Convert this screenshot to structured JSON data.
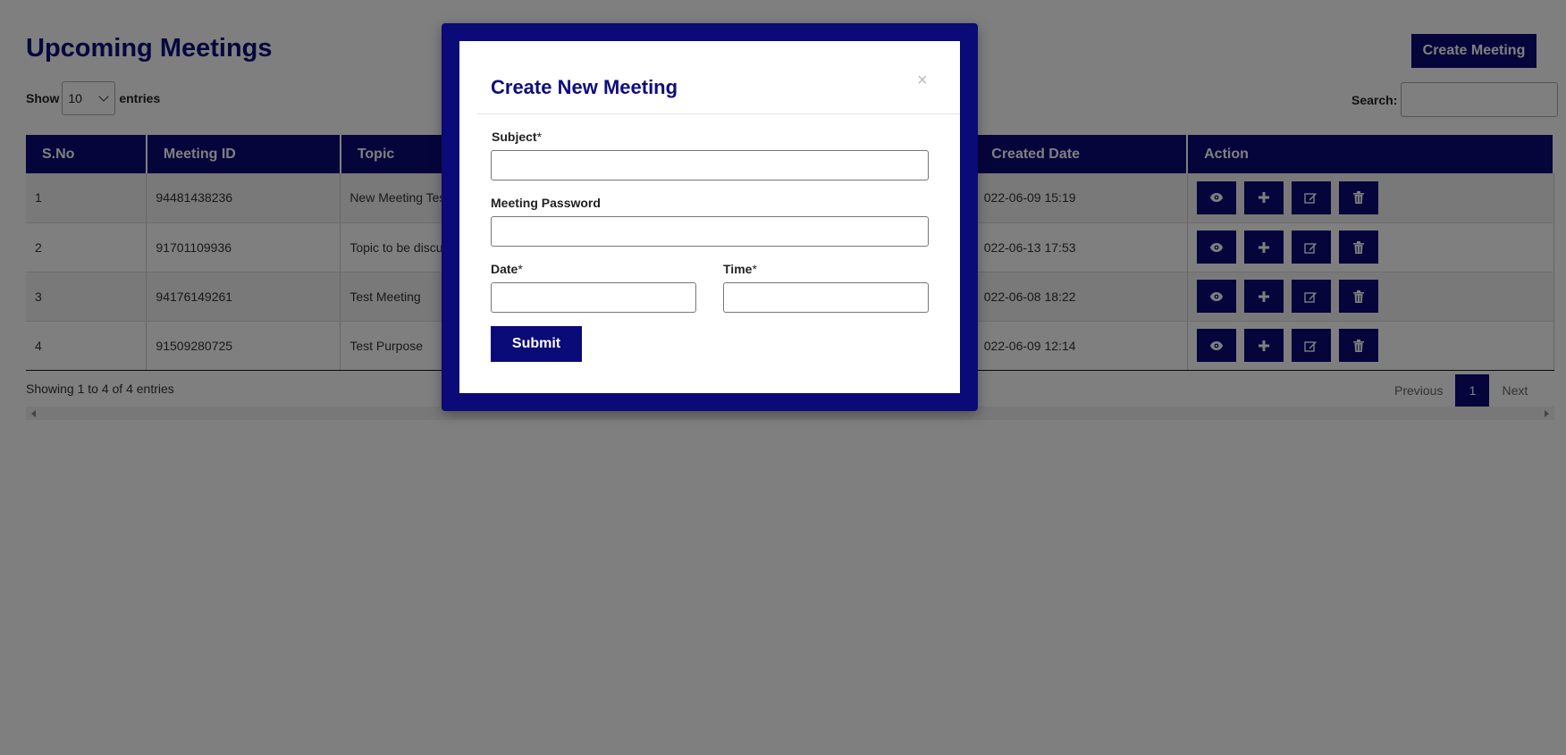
{
  "header": {
    "title": "Upcoming Meetings",
    "create_button": "Create Meeting"
  },
  "length_control": {
    "prefix": "Show",
    "value": "10",
    "suffix": "entries"
  },
  "search": {
    "label": "Search:",
    "value": ""
  },
  "table": {
    "columns": [
      "S.No",
      "Meeting ID",
      "Topic",
      "Created Date",
      "Action"
    ],
    "rows": [
      {
        "sno": "1",
        "meeting_id": "94481438236",
        "topic": "New Meeting Tes",
        "created": "022-06-09 15:19"
      },
      {
        "sno": "2",
        "meeting_id": "91701109936",
        "topic": "Topic to be discu",
        "created": "022-06-13 17:53"
      },
      {
        "sno": "3",
        "meeting_id": "94176149261",
        "topic": "Test Meeting",
        "created": "022-06-08 18:22"
      },
      {
        "sno": "4",
        "meeting_id": "91509280725",
        "topic": "Test Purpose",
        "created": "022-06-09 12:14"
      }
    ],
    "action_icons": [
      "eye-icon",
      "plus-icon",
      "edit-icon",
      "trash-icon"
    ]
  },
  "footer": {
    "info": "Showing 1 to 4 of 4 entries",
    "previous": "Previous",
    "current_page": "1",
    "next": "Next"
  },
  "modal": {
    "title": "Create New Meeting",
    "close": "×",
    "subject_label": "Subject",
    "password_label": "Meeting Password",
    "date_label": "Date",
    "time_label": "Time",
    "required_mark": "*",
    "subject_value": "",
    "password_value": "",
    "date_value": "",
    "time_value": "",
    "submit": "Submit"
  },
  "colors": {
    "primary": "#0a0a78",
    "title": "#0d0d7e",
    "overlay": "rgba(0,0,0,0.5)"
  }
}
